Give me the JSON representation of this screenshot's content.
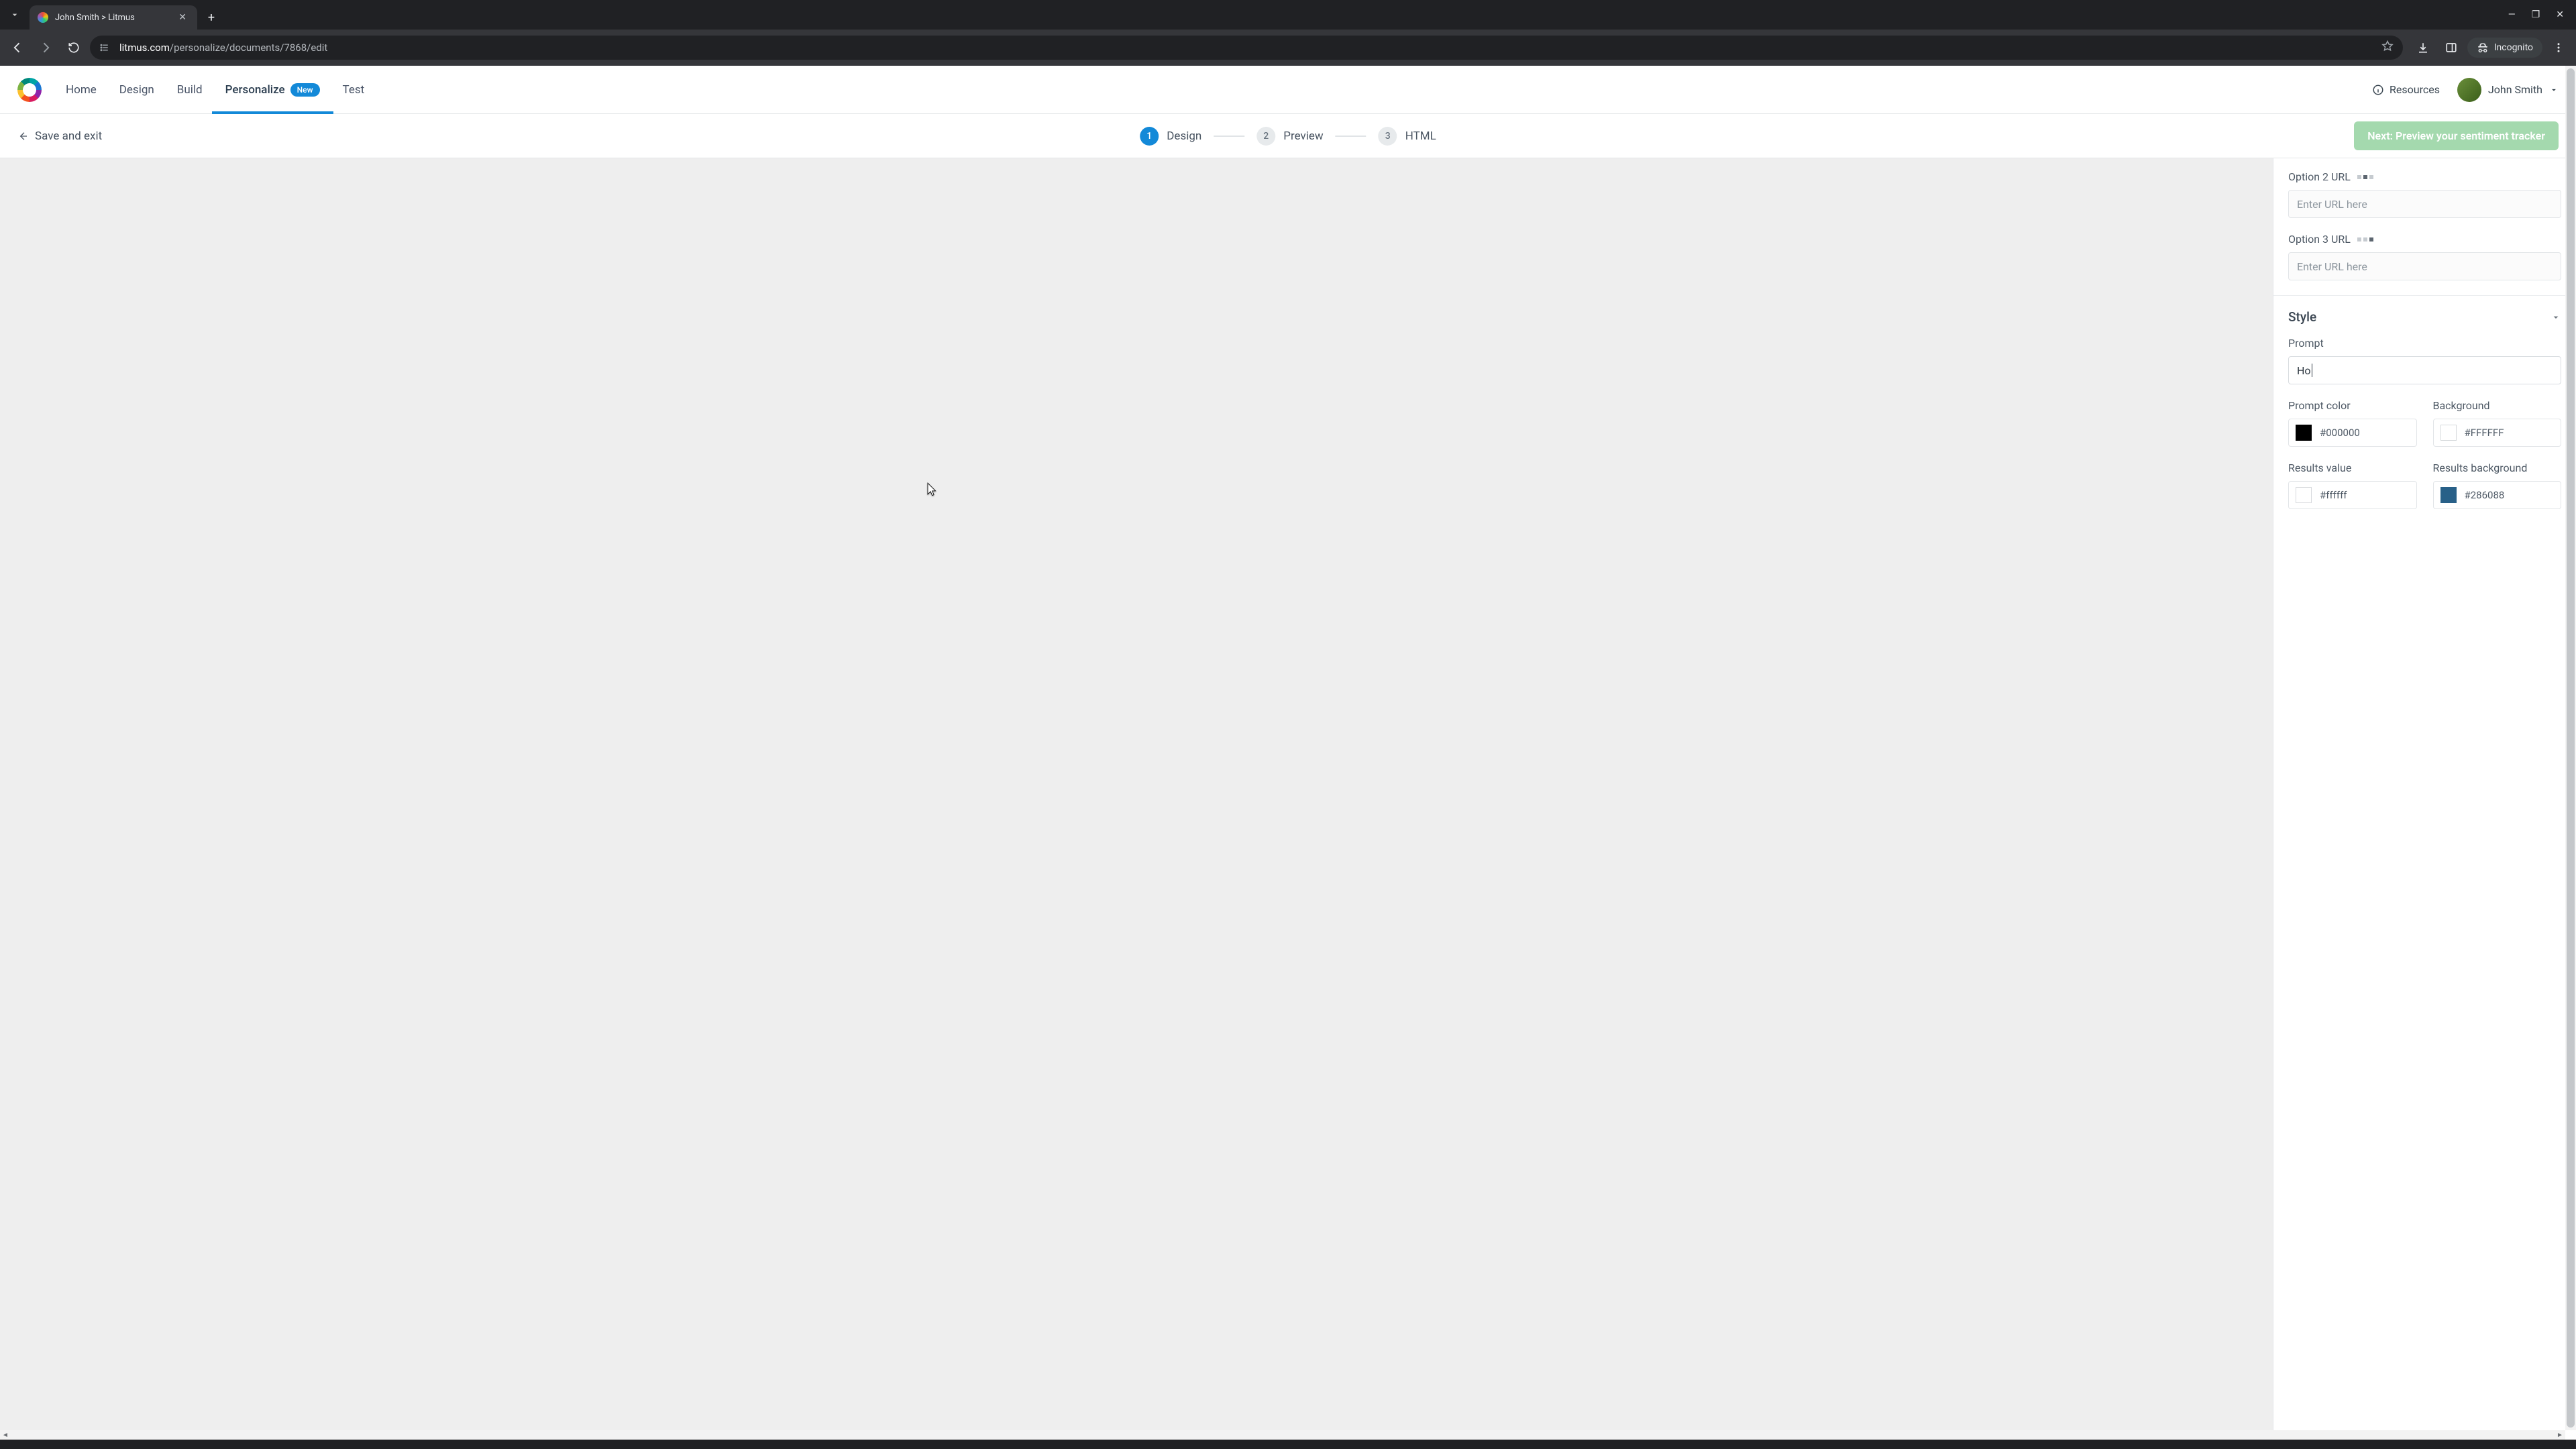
{
  "browser": {
    "tab_title": "John Smith > Litmus",
    "url_domain": "litmus.com",
    "url_path": "/personalize/documents/7868/edit",
    "incognito_label": "Incognito"
  },
  "header": {
    "nav": {
      "home": "Home",
      "design": "Design",
      "build": "Build",
      "personalize": "Personalize",
      "personalize_badge": "New",
      "test": "Test"
    },
    "resources_label": "Resources",
    "user_name": "John Smith"
  },
  "subbar": {
    "save_exit": "Save and exit",
    "steps": {
      "s1_num": "1",
      "s1_label": "Design",
      "s2_num": "2",
      "s2_label": "Preview",
      "s3_num": "3",
      "s3_label": "HTML"
    },
    "next_button": "Next: Preview your sentiment tracker"
  },
  "panel": {
    "option2_label": "Option 2 URL",
    "option3_label": "Option 3 URL",
    "url_placeholder": "Enter URL here",
    "style_section": "Style",
    "prompt_label": "Prompt",
    "prompt_value": "Ho",
    "prompt_color_label": "Prompt color",
    "prompt_color_value": "#000000",
    "background_label": "Background",
    "background_value": "#FFFFFF",
    "results_value_label": "Results value",
    "results_value_value": "#ffffff",
    "results_bg_label": "Results background",
    "results_bg_value": "#286088"
  }
}
